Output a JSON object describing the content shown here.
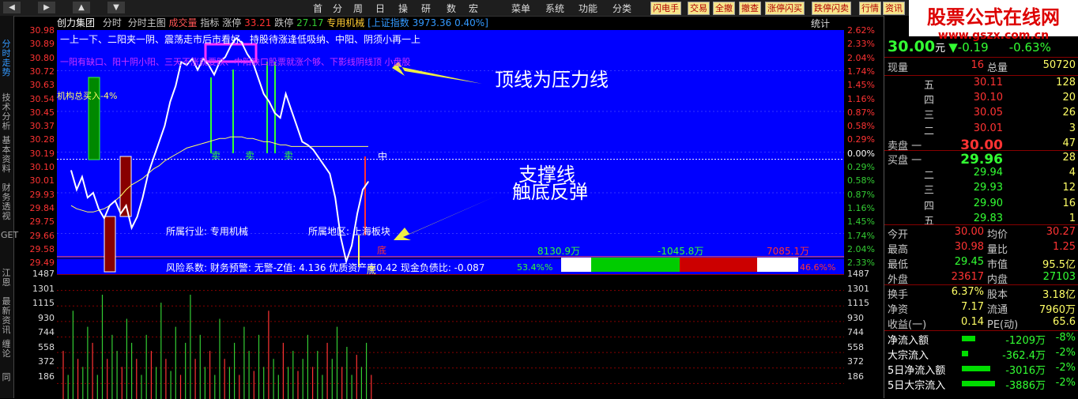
{
  "topbar": {
    "nav": [
      "◀",
      "▶",
      "▲",
      "▼"
    ],
    "menu": [
      "首",
      "分",
      "周",
      "日",
      "操",
      "研",
      "数",
      "宏",
      "菜单",
      "系统",
      "功能",
      "分类"
    ],
    "tools": [
      "闪电手",
      "交易",
      "全撤",
      "撤查",
      "涨停闪买",
      "跌停闪卖",
      "行情",
      "资讯"
    ]
  },
  "watermark": {
    "title": "股票公式在线网",
    "url": "www.gszx.com.cn"
  },
  "sidebar": {
    "tabs": [
      "分时走势",
      "技术分析",
      "基本资料",
      "财务透视",
      "GET",
      "江恩",
      "最新资讯",
      "缠论",
      "同"
    ]
  },
  "infobar": {
    "name": "创力集团",
    "t1": "分时",
    "t2": "分时主图",
    "t3": "成交量",
    "t4": "指标",
    "zt_label": "涨停",
    "zt_val": "33.21",
    "dt_label": "跌停",
    "dt_val": "27.17",
    "sector": "专用机械",
    "index_name": "[上证指数",
    "index_val": "3973.36 0.40%]",
    "stat": "统计"
  },
  "price_axis": [
    "30.98",
    "30.89",
    "30.80",
    "30.72",
    "30.63",
    "30.54",
    "30.45",
    "30.37",
    "30.28",
    "30.19",
    "30.10",
    "30.01",
    "29.93",
    "29.84",
    "29.75",
    "29.66",
    "29.58",
    "29.49"
  ],
  "pct_axis": [
    "2.62%",
    "2.33%",
    "2.04%",
    "1.74%",
    "1.45%",
    "1.16%",
    "0.87%",
    "0.58%",
    "0.29%",
    "0.00%",
    "0.29%",
    "0.58%",
    "0.87%",
    "1.16%",
    "1.45%",
    "1.74%",
    "2.04%",
    "2.33%"
  ],
  "pct_colors": [
    "#ff3333",
    "#ff3333",
    "#ff3333",
    "#ff3333",
    "#ff3333",
    "#ff3333",
    "#ff3333",
    "#ff3333",
    "#ff3333",
    "#ffffff",
    "#33cc33",
    "#33cc33",
    "#33cc33",
    "#33cc33",
    "#33cc33",
    "#33cc33",
    "#33cc33",
    "#33cc33"
  ],
  "vol_axis": [
    "1487",
    "1301",
    "1115",
    "930",
    "744",
    "558",
    "372",
    "186"
  ],
  "chart_text": {
    "line1": "一上一下、二阳夹一阴、震荡走市后市看好、持股待涨逢低吸纳、中阳、阴须小再一上",
    "line2": "一阳有缺口、阳十阴小阳、三天不涨就要跌、中阳缺口股票就涨个够、下影线阴线顶  小盘股",
    "jgzm": "机构总买入-4%",
    "sell1": "卖",
    "sell2": "卖",
    "sell3": "卖",
    "mid": "中",
    "bottom": "底",
    "bottom2": "底",
    "industry": "所属行业: 专用机械",
    "region": "所属地区: 上海板块",
    "risk": "风险系数: 财务预警: 无警-Z值: 4.136 优质资产率0.42 现金负债比: -0.087",
    "buyamt": "8130.9万",
    "net": "-1045.8万",
    "sellamt": "7085.1万",
    "buypct": "53.4%%",
    "sellpct": "46.6%%"
  },
  "annotations": {
    "top": "顶线为压力线",
    "support1": "支撑线",
    "support2": "触底反弹"
  },
  "quote": {
    "price": "30.00",
    "price_unit": "元",
    "chg": "▼-0.19",
    "chgpct": "-0.63%",
    "xianliang_l": "现量",
    "xianliang": "16",
    "zongliang_l": "总量",
    "zongliang": "50720",
    "sell_levels": [
      {
        "l": "五",
        "p": "30.11",
        "v": "128"
      },
      {
        "l": "四",
        "p": "30.10",
        "v": "20"
      },
      {
        "l": "三",
        "p": "30.05",
        "v": "26"
      },
      {
        "l": "二",
        "p": "30.01",
        "v": "3"
      },
      {
        "l": "卖盘 一",
        "p": "30.00",
        "v": "47"
      }
    ],
    "buy_levels": [
      {
        "l": "买盘 一",
        "p": "29.96",
        "v": "28"
      },
      {
        "l": "二",
        "p": "29.94",
        "v": "4"
      },
      {
        "l": "三",
        "p": "29.93",
        "v": "12"
      },
      {
        "l": "四",
        "p": "29.90",
        "v": "16"
      },
      {
        "l": "五",
        "p": "29.83",
        "v": "1"
      }
    ],
    "stats": [
      {
        "a": "今开",
        "av": "30.00",
        "b": "均价",
        "bv": "30.27"
      },
      {
        "a": "最高",
        "av": "30.98",
        "b": "量比",
        "bv": "1.25"
      },
      {
        "a": "最低",
        "av": "29.45",
        "b": "市值",
        "bv": "95.5亿"
      },
      {
        "a": "外盘",
        "av": "23617",
        "b": "内盘",
        "bv": "27103"
      }
    ],
    "stats2": [
      {
        "a": "换手",
        "av": "6.37%",
        "b": "股本",
        "bv": "3.18亿"
      },
      {
        "a": "净资",
        "av": "7.17",
        "b": "流通",
        "bv": "7960万"
      },
      {
        "a": "收益(一)",
        "av": "0.14",
        "b": "PE(动)",
        "bv": "65.6"
      }
    ],
    "flows": [
      {
        "l": "净流入额",
        "v": "-1209万",
        "p": "-8%",
        "bar": 0.35
      },
      {
        "l": "大宗流入",
        "v": "-362.4万",
        "p": "-2%",
        "bar": 0.1
      },
      {
        "l": "5日净流入额",
        "v": "-3016万",
        "p": "-2%",
        "bar": 0.85
      },
      {
        "l": "5日大宗流入",
        "v": "-3886万",
        "p": "-2%",
        "bar": 1.0
      }
    ]
  },
  "chart_data": {
    "type": "line",
    "title": "",
    "xlabel": "",
    "ylabel": "",
    "ylim": [
      29.49,
      30.98
    ],
    "price": [
      30.12,
      30.0,
      30.08,
      29.95,
      29.98,
      29.88,
      29.82,
      29.9,
      29.93,
      29.85,
      29.9,
      29.76,
      29.83,
      29.95,
      30.1,
      30.2,
      30.3,
      30.4,
      30.55,
      30.65,
      30.8,
      30.78,
      30.82,
      30.75,
      30.82,
      30.78,
      30.72,
      30.8,
      30.83,
      30.9,
      30.95,
      30.92,
      30.85,
      30.8,
      30.7,
      30.6,
      30.55,
      30.48,
      30.45,
      30.6,
      30.5,
      30.4,
      30.3,
      30.28,
      30.25,
      30.2,
      30.15,
      30.1,
      29.95,
      29.7,
      29.55,
      29.65,
      29.85,
      30.0,
      30.05
    ],
    "avg_price": [
      29.9,
      29.88,
      29.87,
      29.86,
      29.86,
      29.87,
      29.88,
      29.9,
      29.93,
      29.96,
      30.0,
      30.03,
      30.05,
      30.07,
      30.1,
      30.13,
      30.15,
      30.18,
      30.2,
      30.22,
      30.24,
      30.26,
      30.27,
      30.28,
      30.29,
      30.3,
      30.31,
      30.32,
      30.32,
      30.33,
      30.33,
      30.33,
      30.32,
      30.32,
      30.31,
      30.3,
      30.3,
      30.29,
      30.28,
      30.28,
      30.27,
      30.27,
      30.27,
      30.27,
      30.27,
      30.27,
      30.27,
      30.27,
      30.27,
      30.27,
      30.27,
      30.27,
      30.27,
      30.27,
      30.27
    ],
    "volume": [
      600,
      300,
      1100,
      500,
      400,
      900,
      700,
      300,
      1300,
      500,
      800,
      600,
      400,
      1000,
      700,
      500,
      300,
      800,
      600,
      400,
      1200,
      500,
      350,
      900,
      300,
      700,
      1300,
      500,
      800,
      400,
      600,
      300,
      1000,
      500,
      400,
      700,
      300,
      900,
      600,
      350,
      800,
      400,
      1100,
      500,
      300,
      700,
      400,
      600,
      350,
      500,
      800,
      400,
      600,
      300,
      700,
      500,
      900,
      400,
      650,
      300,
      550,
      400,
      700,
      300
    ]
  }
}
